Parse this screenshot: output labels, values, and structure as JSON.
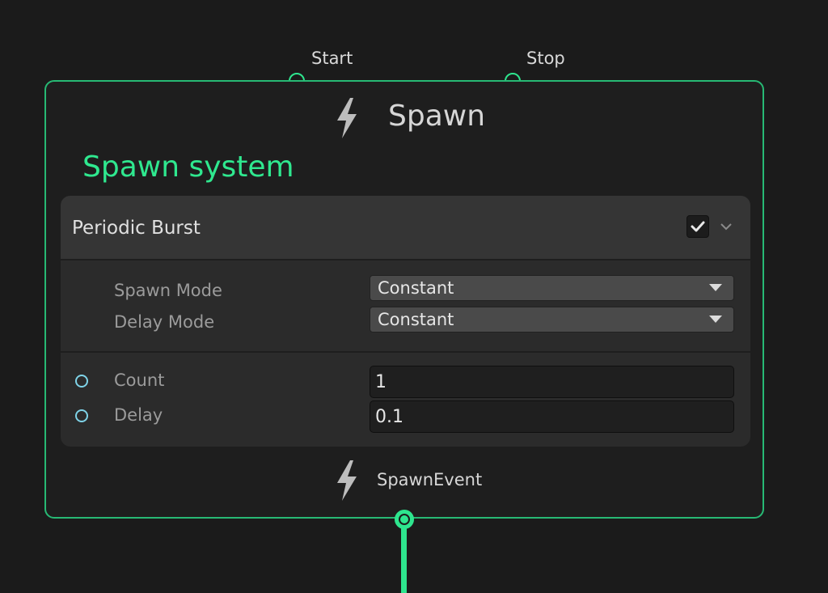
{
  "flow_ports": {
    "inputs": [
      {
        "label": "Start"
      },
      {
        "label": "Stop"
      }
    ],
    "output": {
      "label": "SpawnEvent"
    }
  },
  "node": {
    "title": "Spawn",
    "icon": "lightning-icon",
    "context_label": "Spawn system",
    "accent_color": "#2ee58e"
  },
  "block": {
    "title": "Periodic Burst",
    "enabled": true,
    "settings": [
      {
        "label": "Spawn Mode",
        "value": "Constant"
      },
      {
        "label": "Delay Mode",
        "value": "Constant"
      }
    ],
    "properties": [
      {
        "label": "Count",
        "value": "1"
      },
      {
        "label": "Delay",
        "value": "0.1"
      }
    ]
  }
}
